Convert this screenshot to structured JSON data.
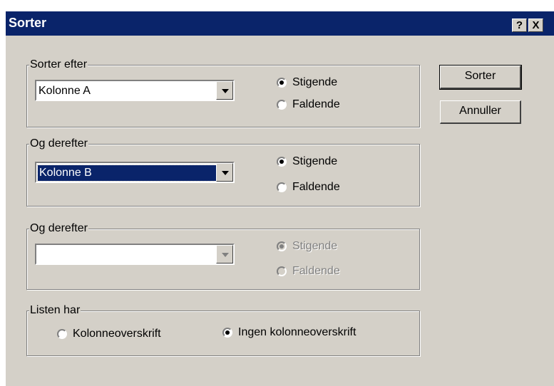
{
  "window": {
    "title": "Sorter",
    "help_label": "?",
    "close_label": "X"
  },
  "sort_by": {
    "legend": "Sorter efter",
    "combo_value": "Kolonne A",
    "ascending_label": "Stigende",
    "descending_label": "Faldende",
    "selected": "ascending"
  },
  "then_by_1": {
    "legend": "Og derefter",
    "combo_value": "Kolonne B",
    "ascending_label": "Stigende",
    "descending_label": "Faldende",
    "selected": "ascending"
  },
  "then_by_2": {
    "legend": "Og derefter",
    "combo_value": "",
    "ascending_label": "Stigende",
    "descending_label": "Faldende",
    "selected": "ascending",
    "disabled": true
  },
  "header_row": {
    "legend": "Listen har",
    "option_header": "Kolonneoverskrift",
    "option_no_header": "Ingen kolonneoverskrift",
    "selected": "no_header"
  },
  "buttons": {
    "sort_label": "Sorter",
    "cancel_label": "Annuller"
  }
}
